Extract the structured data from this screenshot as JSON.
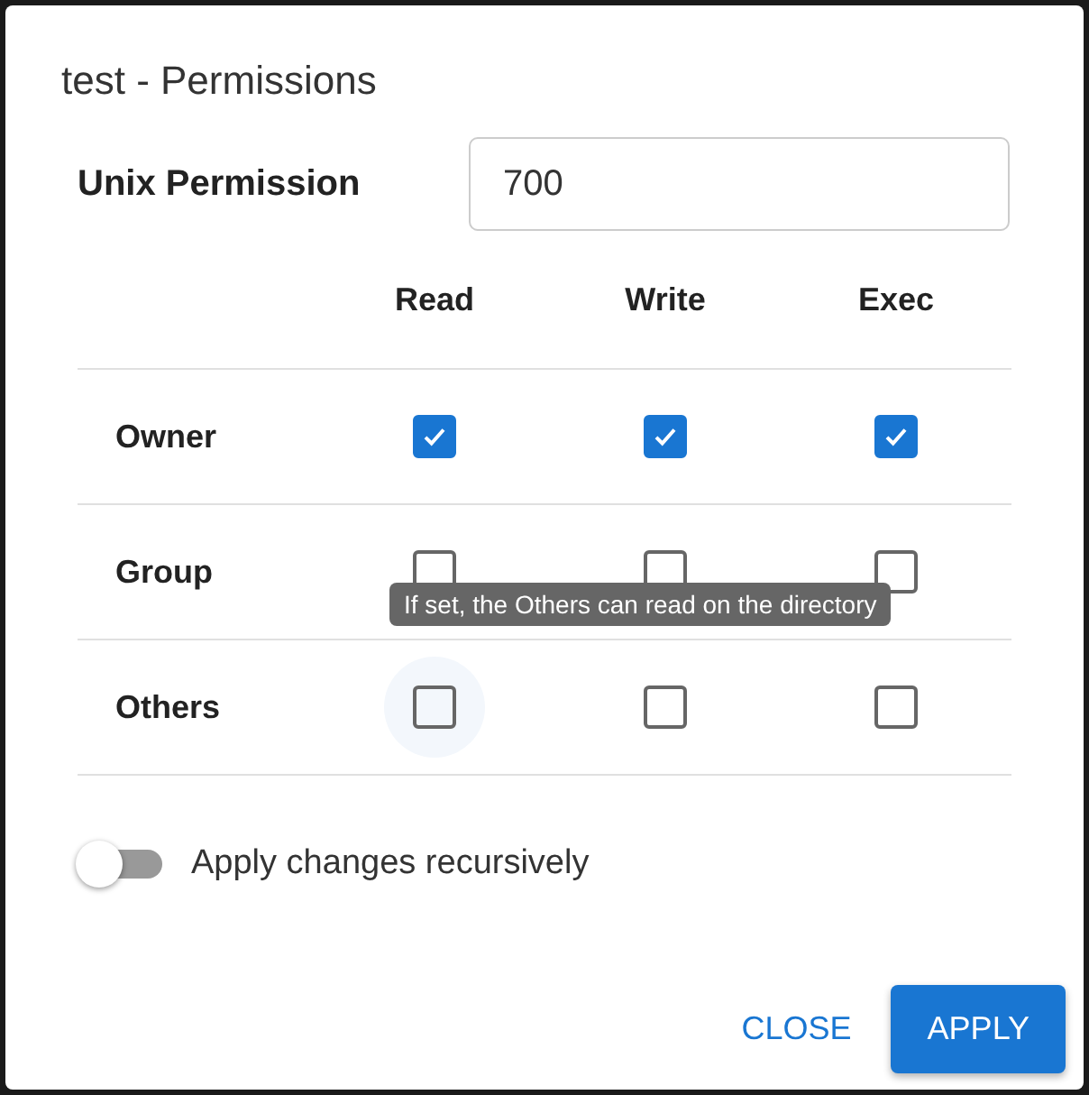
{
  "dialog": {
    "title": "test - Permissions"
  },
  "unix_permission": {
    "label": "Unix Permission",
    "value": "700"
  },
  "table": {
    "columns": [
      "Read",
      "Write",
      "Exec"
    ],
    "rows": [
      {
        "label": "Owner",
        "cells": [
          {
            "checked": true,
            "hovered": false
          },
          {
            "checked": true,
            "hovered": false
          },
          {
            "checked": true,
            "hovered": false
          }
        ]
      },
      {
        "label": "Group",
        "cells": [
          {
            "checked": false,
            "hovered": false
          },
          {
            "checked": false,
            "hovered": false
          },
          {
            "checked": false,
            "hovered": false
          }
        ]
      },
      {
        "label": "Others",
        "cells": [
          {
            "checked": false,
            "hovered": true
          },
          {
            "checked": false,
            "hovered": false
          },
          {
            "checked": false,
            "hovered": false
          }
        ]
      }
    ]
  },
  "tooltip": "If set, the Others can read on the directory",
  "recursive": {
    "label": "Apply changes recursively",
    "on": false
  },
  "buttons": [
    {
      "label": "CLOSE",
      "kind": "text"
    },
    {
      "label": "APPLY",
      "kind": "primary"
    }
  ]
}
